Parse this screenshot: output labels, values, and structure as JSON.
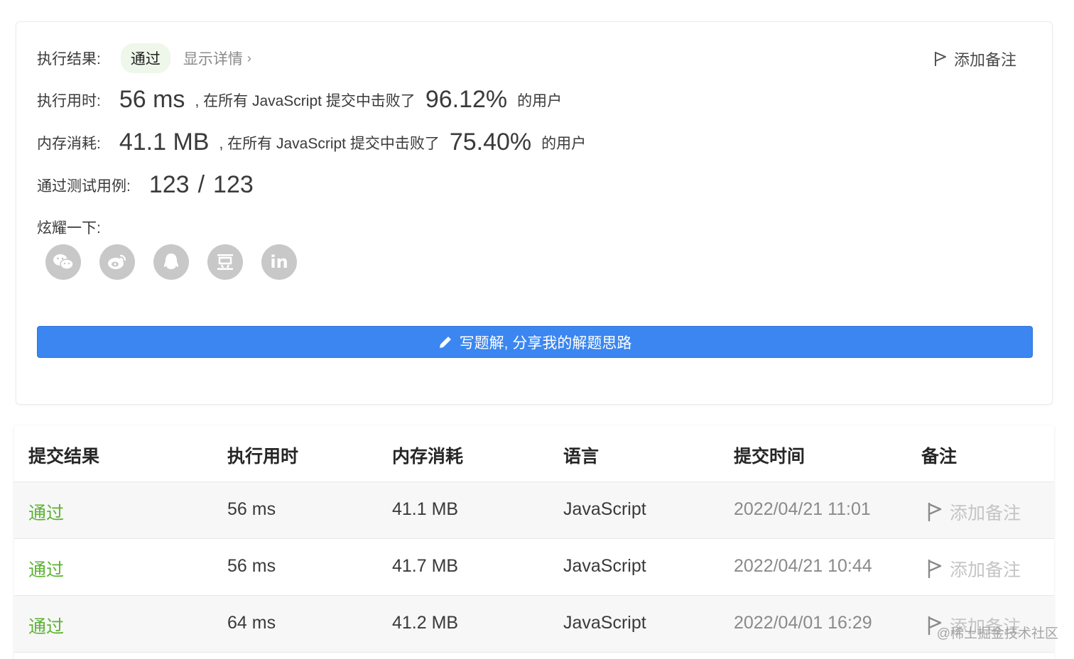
{
  "result": {
    "label": "执行结果:",
    "status": "通过",
    "details_link": "显示详情",
    "add_note": "添加备注"
  },
  "runtime": {
    "label": "执行用时:",
    "value": "56 ms",
    "middle_text": ", 在所有 JavaScript 提交中击败了",
    "percent": "96.12%",
    "suffix": "的用户"
  },
  "memory": {
    "label": "内存消耗:",
    "value": "41.1 MB",
    "middle_text": ", 在所有 JavaScript 提交中击败了",
    "percent": "75.40%",
    "suffix": "的用户"
  },
  "testcases": {
    "label": "通过测试用例:",
    "passed": "123",
    "separator": "/",
    "total": "123"
  },
  "share": {
    "label": "炫耀一下:",
    "icons": [
      "wechat-icon",
      "weibo-icon",
      "qq-icon",
      "douban-icon",
      "linkedin-icon"
    ]
  },
  "write_solution": {
    "label": "写题解, 分享我的解题思路",
    "color": "#3b86f0"
  },
  "table": {
    "headers": [
      "提交结果",
      "执行用时",
      "内存消耗",
      "语言",
      "提交时间",
      "备注"
    ],
    "rows": [
      {
        "status": "通过",
        "runtime": "56 ms",
        "memory": "41.1 MB",
        "language": "JavaScript",
        "time": "2022/04/21 11:01",
        "note": "添加备注"
      },
      {
        "status": "通过",
        "runtime": "56 ms",
        "memory": "41.7 MB",
        "language": "JavaScript",
        "time": "2022/04/21 10:44",
        "note": "添加备注"
      },
      {
        "status": "通过",
        "runtime": "64 ms",
        "memory": "41.2 MB",
        "language": "JavaScript",
        "time": "2022/04/01 16:29",
        "note": "添加备注"
      }
    ]
  },
  "watermark": "@稀土掘金技术社区",
  "colors": {
    "pass_green": "#5cb233",
    "badge_bg": "#eef7ea",
    "share_gray": "#c8c8c8"
  }
}
